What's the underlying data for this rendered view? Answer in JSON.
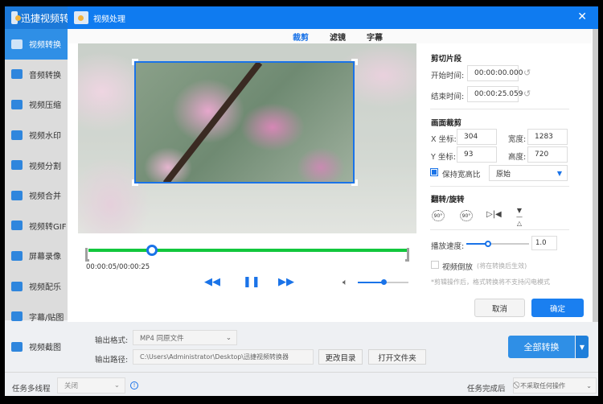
{
  "app": {
    "title": "迅捷视频转",
    "accent": "#1b78d8"
  },
  "sidebar": {
    "items": [
      {
        "label": "视频转换",
        "icon": "video-convert-icon",
        "active": true
      },
      {
        "label": "音频转换",
        "icon": "audio-convert-icon"
      },
      {
        "label": "视频压缩",
        "icon": "compress-icon"
      },
      {
        "label": "视频水印",
        "icon": "watermark-icon"
      },
      {
        "label": "视频分割",
        "icon": "split-icon"
      },
      {
        "label": "视频合并",
        "icon": "merge-icon"
      },
      {
        "label": "视频转GIF",
        "icon": "gif-icon"
      },
      {
        "label": "屏幕录像",
        "icon": "record-icon"
      },
      {
        "label": "视频配乐",
        "icon": "music-icon"
      },
      {
        "label": "字幕/贴图",
        "icon": "subtitle-icon"
      },
      {
        "label": "视频截图",
        "icon": "screenshot-icon"
      }
    ]
  },
  "dialog": {
    "title": "视频处理",
    "tabs": [
      {
        "label": "裁剪",
        "active": true
      },
      {
        "label": "滤镜"
      },
      {
        "label": "字幕"
      }
    ]
  },
  "player": {
    "time": "00:00:05/00:00:25",
    "progress_fraction": 0.2,
    "volume_fraction": 0.5
  },
  "clip": {
    "title": "剪切片段",
    "start_label": "开始时间:",
    "start": "00:00:00.000",
    "end_label": "结束时间:",
    "end": "00:00:25.059"
  },
  "crop": {
    "title": "画面裁剪",
    "x_label": "X 坐标:",
    "x": "304",
    "w_label": "宽度:",
    "w": "1283",
    "y_label": "Y 坐标:",
    "y": "93",
    "h_label": "高度:",
    "h": "720",
    "keep_ratio_label": "保持宽高比",
    "keep_ratio": true,
    "ratio": "原始"
  },
  "rotate": {
    "title": "翻转/旋转",
    "rot_cw": "90°",
    "rot_ccw": "90°"
  },
  "speed": {
    "label": "播放速度:",
    "value": "1.0"
  },
  "reverse": {
    "label": "视频倒放",
    "hint": "(将在转换后生效)",
    "checked": false
  },
  "note": "*剪辑操作后，格式转换将不支持闪电模式",
  "buttons": {
    "cancel": "取消",
    "ok": "确定"
  },
  "output": {
    "format_label": "输出格式:",
    "format": "MP4  同原文件",
    "path_label": "输出路径:",
    "path": "C:\\Users\\Administrator\\Desktop\\迅捷视频转换器",
    "change_dir": "更改目录",
    "open_folder": "打开文件夹",
    "convert_all": "全部转换"
  },
  "status": {
    "threads_label": "任务多线程",
    "threads": "关闭",
    "after_label": "任务完成后",
    "after": "不采取任何操作"
  }
}
